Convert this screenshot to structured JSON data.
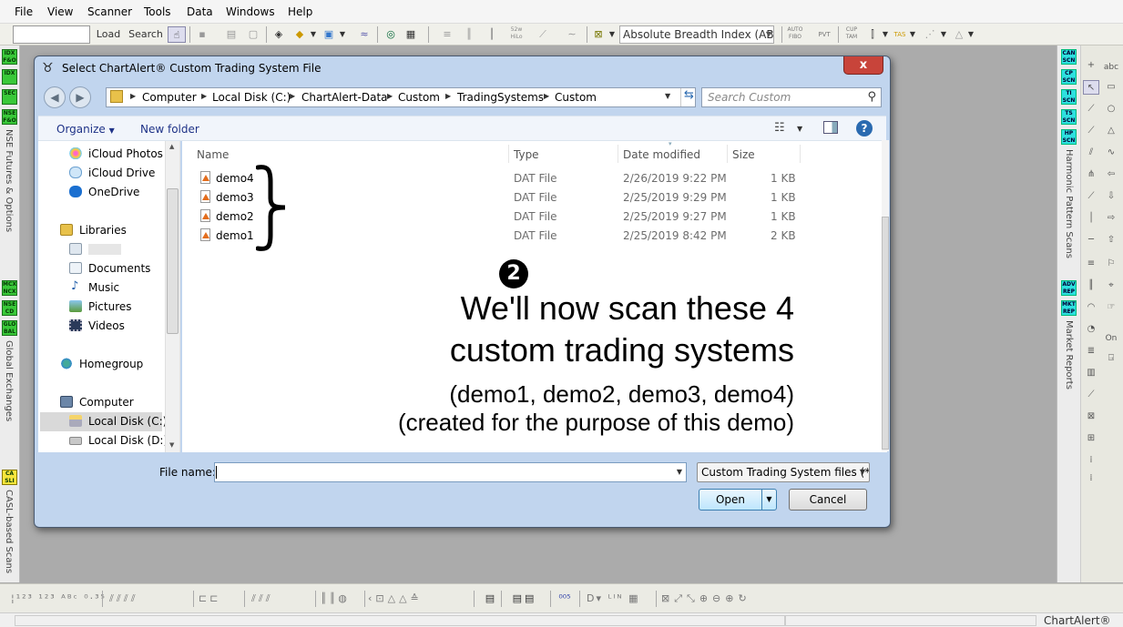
{
  "menu": [
    "File",
    "View",
    "Scanner",
    "Tools",
    "Data",
    "Windows",
    "Help"
  ],
  "toolbar": {
    "load_label": "Load",
    "search_label": "Search",
    "indicator_select": "Absolute Breadth Index (ABI",
    "icons": [
      "52w\nHiLo",
      "AUTO\nFIBO",
      "PVT",
      "CUP\nTAM",
      "TAS"
    ]
  },
  "left_panel": {
    "buttons_top": [
      "IDX\nF&O",
      "IDX",
      "SEC",
      "NSE\nF&O"
    ],
    "label_top": "NSE Futures & Options",
    "buttons_mid": [
      "MCX\nNCX",
      "NSE\nCD",
      "GLO\nBAL"
    ],
    "label_mid": "Global Exchanges",
    "buttons_bot": [
      "CA\nSLI"
    ],
    "label_bot": "CASL-based Scans"
  },
  "right_panel": {
    "buttons_top": [
      "CAN\nSCN",
      "CP\nSCN",
      "TI\nSCN",
      "TS\nSCN",
      "HP\nSCN"
    ],
    "label_top": "Harmonic Pattern Scans",
    "buttons_bot": [
      "ADV\nREP",
      "MKT\nREP"
    ],
    "label_bot": "Market Reports",
    "draw_tools": [
      "abc",
      "On"
    ]
  },
  "dialog": {
    "title": "Select ChartAlert® Custom Trading System File",
    "close": "x",
    "breadcrumb": [
      "Computer",
      "Local Disk (C:)",
      "ChartAlert-Data",
      "Custom",
      "TradingSystems",
      "Custom"
    ],
    "search_placeholder": "Search Custom",
    "organize": "Organize",
    "new_folder": "New folder",
    "nav_items": {
      "icloud_photos": "iCloud Photos",
      "icloud_drive": "iCloud Drive",
      "onedrive": "OneDrive",
      "libraries": "Libraries",
      "documents": "Documents",
      "music": "Music",
      "pictures": "Pictures",
      "videos": "Videos",
      "homegroup": "Homegroup",
      "computer": "Computer",
      "local_c": "Local Disk (C:)",
      "local_d": "Local Disk (D:)"
    },
    "columns": {
      "name": "Name",
      "type": "Type",
      "date": "Date modified",
      "size": "Size"
    },
    "files": [
      {
        "name": "demo4",
        "type": "DAT File",
        "date": "2/26/2019 9:22 PM",
        "size": "1 KB"
      },
      {
        "name": "demo3",
        "type": "DAT File",
        "date": "2/25/2019 9:29 PM",
        "size": "1 KB"
      },
      {
        "name": "demo2",
        "type": "DAT File",
        "date": "2/25/2019 9:27 PM",
        "size": "1 KB"
      },
      {
        "name": "demo1",
        "type": "DAT File",
        "date": "2/25/2019 8:42 PM",
        "size": "2 KB"
      }
    ],
    "annotation": {
      "badge": "2",
      "line1": "We'll now scan these 4",
      "line2": "custom trading systems",
      "line3": "(demo1, demo2, demo3, demo4)",
      "line4": "(created for the purpose of this demo)"
    },
    "file_name_label": "File name:",
    "file_name_value": "",
    "filter": "Custom Trading System files (*",
    "open_label": "Open",
    "cancel_label": "Cancel"
  },
  "status": {
    "brand": "ChartAlert®"
  }
}
